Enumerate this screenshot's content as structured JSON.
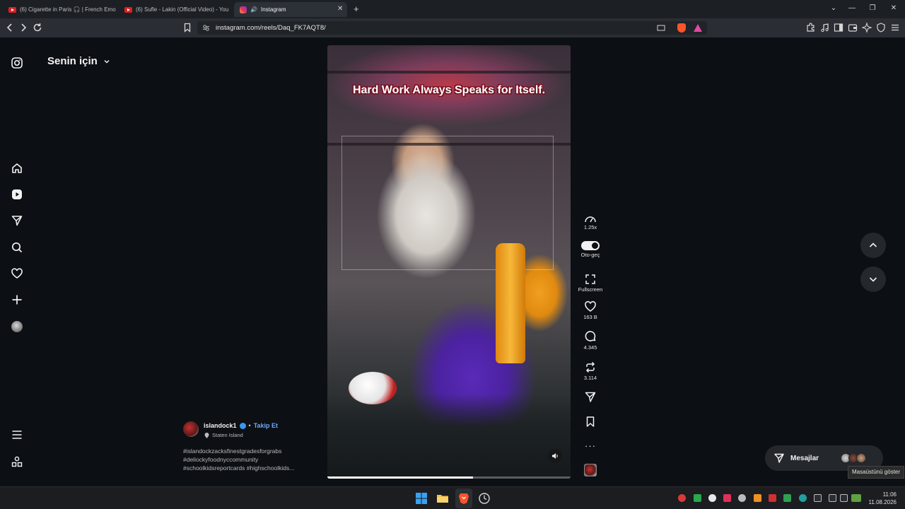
{
  "browser": {
    "tabs": [
      {
        "title": "(6) Cigarette in Paris 🎧 | French Emo",
        "icon": "youtube-icon"
      },
      {
        "title": "(6) Sufle - Lakin (Official Video) - You",
        "icon": "youtube-icon"
      },
      {
        "title": "Instagram",
        "icon": "instagram-icon",
        "active": true
      }
    ],
    "new_tab": "+",
    "url": "instagram.com/reels/Daq_FK7AQT8/"
  },
  "sidebar": {
    "feed_title": "Senin için"
  },
  "reel": {
    "overlay_text": "Hard Work Always Speaks for Itself.",
    "progress": 0.6
  },
  "actions": {
    "speed": "1.25x",
    "autoplay_label": "Oto-geç",
    "fullscreen_label": "Fullscreen",
    "likes": "163 B",
    "comments": "4.345",
    "reposts": "3.114"
  },
  "author": {
    "username": "islandock1",
    "follow_label": "Takip Et",
    "location": "Staten Island",
    "hashtags": [
      "#islandockzacksfinestgradesforgrabs",
      "#deliockyfoodnyccommunity",
      "#schoolkidsreportcards #highschoolkids..."
    ]
  },
  "messages": {
    "label": "Mesajlar"
  },
  "tooltip": "Masaüstünü göster",
  "taskbar": {
    "time": "11:06",
    "date": "11.08.2026"
  },
  "colors": {
    "accent_link": "#6ea8fe",
    "verified": "#3797f0"
  }
}
